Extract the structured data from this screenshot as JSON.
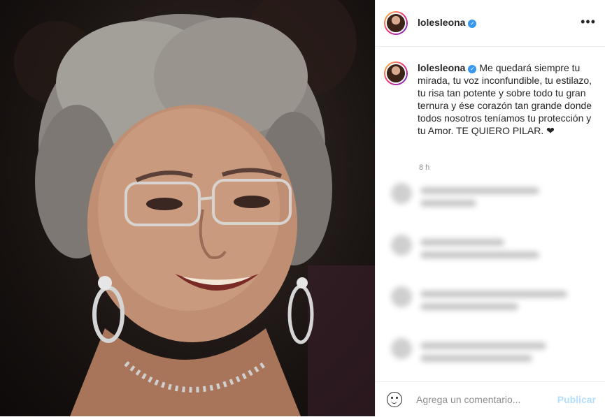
{
  "post": {
    "username": "lolesleona",
    "caption": "Me quedará siempre tu mirada, tu voz inconfundible, tu estilazo, tu risa tan potente y sobre todo tu gran ternura y ése corazón tan grande donde todos nosotros teníamos tu protección y tu Amor. TE QUIERO PILAR. ❤",
    "time": "8 h",
    "more_icon": "•••"
  },
  "footer": {
    "comment_placeholder": "Agrega un comentario...",
    "publish_label": "Publicar"
  }
}
